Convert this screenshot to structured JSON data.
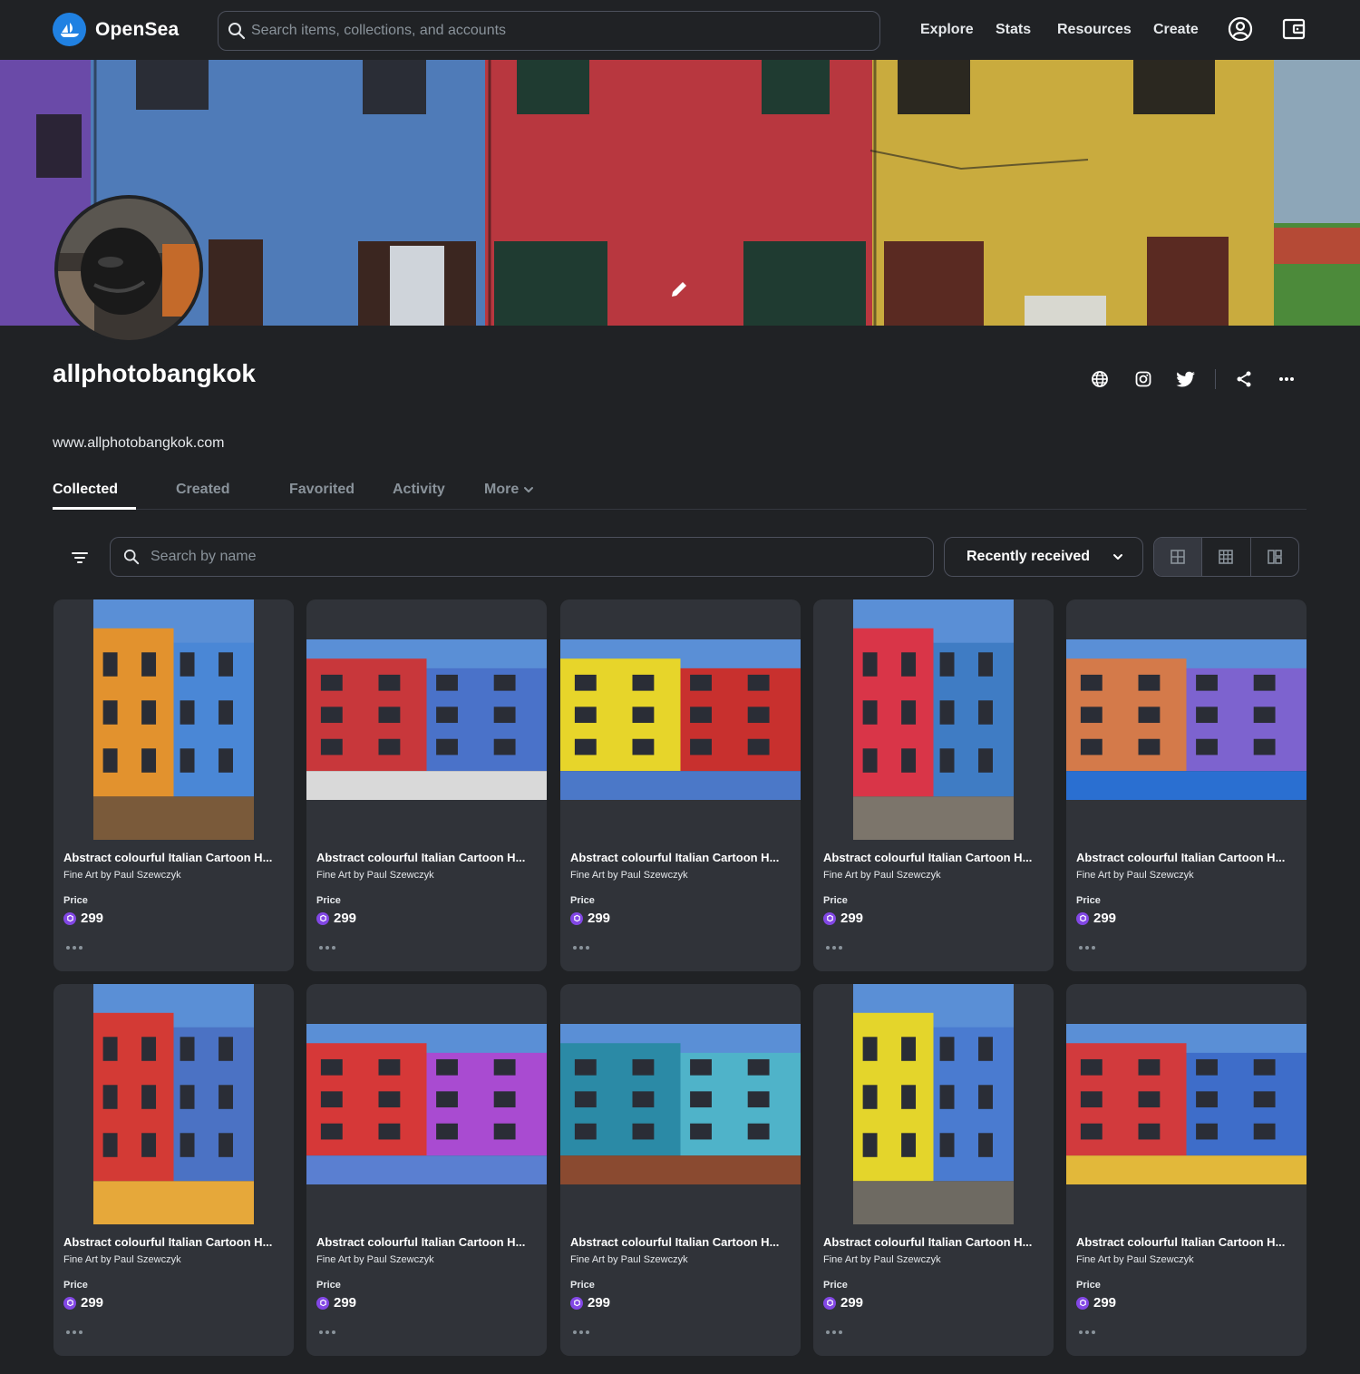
{
  "header": {
    "brand": "OpenSea",
    "search_placeholder": "Search items, collections, and accounts",
    "nav": [
      "Explore",
      "Stats",
      "Resources",
      "Create"
    ],
    "icons": [
      "account-icon",
      "wallet-icon"
    ]
  },
  "banner": {
    "edit_icon": "pencil-icon"
  },
  "profile": {
    "username": "allphotobangkok",
    "website": "www.allphotobangkok.com",
    "social_icons": [
      "globe-icon",
      "instagram-icon",
      "twitter-icon",
      "share-icon",
      "more-icon"
    ]
  },
  "tabs": {
    "items": [
      "Collected",
      "Created",
      "Favorited",
      "Activity",
      "More"
    ],
    "active": "Collected"
  },
  "filters": {
    "search_placeholder": "Search by name",
    "sort_label": "Recently received",
    "view_modes": [
      "large-grid-icon",
      "small-grid-icon",
      "mosaic-icon"
    ]
  },
  "cards": [
    {
      "title": "Abstract colourful Italian Cartoon H...",
      "collection": "Fine Art by Paul Szewczyk",
      "price_label": "Price",
      "price": "299",
      "orientation": "portrait",
      "palette": [
        "#e2922e",
        "#4a87d6",
        "#7a5a3a"
      ]
    },
    {
      "title": "Abstract colourful Italian Cartoon H...",
      "collection": "Fine Art by Paul Szewczyk",
      "price_label": "Price",
      "price": "299",
      "orientation": "landscape",
      "palette": [
        "#c8373b",
        "#4a72c9",
        "#d9d9d9"
      ]
    },
    {
      "title": "Abstract colourful Italian Cartoon H...",
      "collection": "Fine Art by Paul Szewczyk",
      "price_label": "Price",
      "price": "299",
      "orientation": "landscape",
      "palette": [
        "#e7d52a",
        "#c8302e",
        "#4b78c8"
      ]
    },
    {
      "title": "Abstract colourful Italian Cartoon H...",
      "collection": "Fine Art by Paul Szewczyk",
      "price_label": "Price",
      "price": "299",
      "orientation": "portrait",
      "palette": [
        "#d93548",
        "#3f7cc4",
        "#7c756b"
      ]
    },
    {
      "title": "Abstract colourful Italian Cartoon H...",
      "collection": "Fine Art by Paul Szewczyk",
      "price_label": "Price",
      "price": "299",
      "orientation": "landscape",
      "palette": [
        "#d47a4a",
        "#7d63cf",
        "#2a6fd1"
      ]
    },
    {
      "title": "Abstract colourful Italian Cartoon H...",
      "collection": "Fine Art by Paul Szewczyk",
      "price_label": "Price",
      "price": "299",
      "orientation": "portrait",
      "palette": [
        "#d33a35",
        "#4b72c4",
        "#e6a83a"
      ]
    },
    {
      "title": "Abstract colourful Italian Cartoon H...",
      "collection": "Fine Art by Paul Szewczyk",
      "price_label": "Price",
      "price": "299",
      "orientation": "landscape",
      "palette": [
        "#d63838",
        "#a94bd1",
        "#5a7fd1"
      ]
    },
    {
      "title": "Abstract colourful Italian Cartoon H...",
      "collection": "Fine Art by Paul Szewczyk",
      "price_label": "Price",
      "price": "299",
      "orientation": "landscape",
      "palette": [
        "#2b8aa6",
        "#4fb3c9",
        "#8a4a30"
      ]
    },
    {
      "title": "Abstract colourful Italian Cartoon H...",
      "collection": "Fine Art by Paul Szewczyk",
      "price_label": "Price",
      "price": "299",
      "orientation": "portrait",
      "palette": [
        "#e4d52b",
        "#4a7bd0",
        "#6e6a62"
      ]
    },
    {
      "title": "Abstract colourful Italian Cartoon H...",
      "collection": "Fine Art by Paul Szewczyk",
      "price_label": "Price",
      "price": "299",
      "orientation": "landscape",
      "palette": [
        "#d23a3d",
        "#3e6dc9",
        "#e2b83a"
      ]
    }
  ],
  "colors": {
    "background": "#202225",
    "card": "#303339",
    "border": "#4c505c",
    "brand": "#2081e2",
    "price_token": "#8247e5"
  }
}
